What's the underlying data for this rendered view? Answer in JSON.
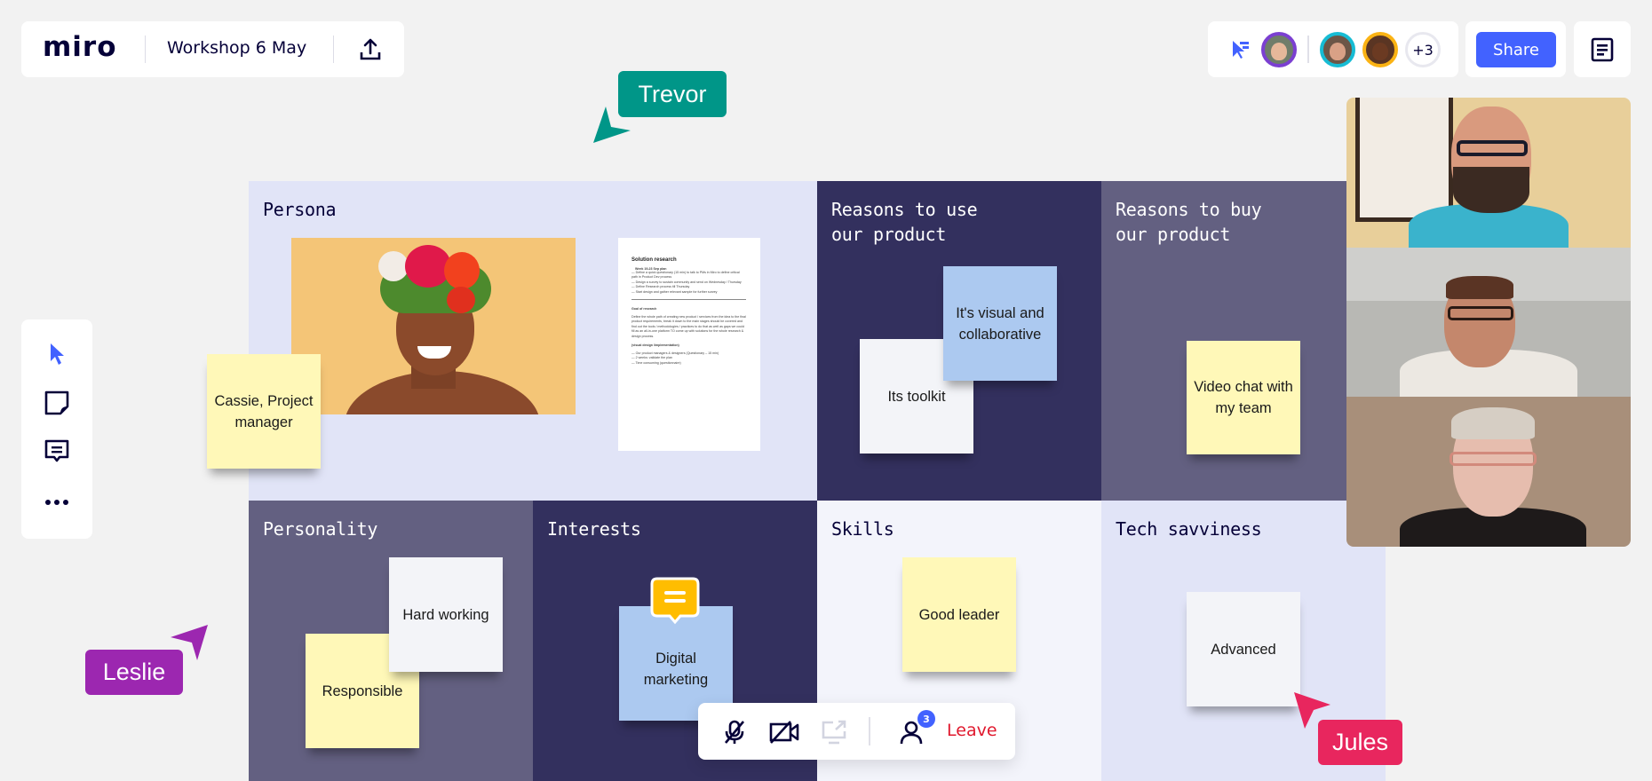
{
  "app": {
    "logo": "miro",
    "board_title": "Workshop 6 May",
    "upload_icon": "upload-icon"
  },
  "collaborators": {
    "follow_icon": "follow-cursor-icon",
    "avatars": [
      {
        "name": "user-avatar-1",
        "ring": "#7b3fd1",
        "skin": "#e6b89a",
        "bg": "#6f7d6a"
      },
      {
        "name": "user-avatar-2",
        "ring": "#17bcd4",
        "skin": "#d9a186",
        "bg": "#6c5647"
      },
      {
        "name": "user-avatar-3",
        "ring": "#fbb313",
        "skin": "#6b3a22",
        "bg": "#5a3523"
      }
    ],
    "overflow_count": "+3"
  },
  "share": {
    "label": "Share",
    "color": "#4262ff"
  },
  "notes_icon": "document-icon",
  "toolbar": {
    "tools": [
      {
        "name": "select-tool",
        "icon": "cursor-icon"
      },
      {
        "name": "sticky-note-tool",
        "icon": "sticky-note-icon"
      },
      {
        "name": "comment-tool",
        "icon": "comment-icon"
      },
      {
        "name": "more-tools",
        "icon": "more-icon"
      }
    ]
  },
  "board": {
    "panels": [
      {
        "id": "persona",
        "title": "Persona",
        "bg": "#e1e4f7",
        "theme": "light"
      },
      {
        "id": "reasons-use",
        "title": "Reasons to use\nour product",
        "bg": "#33305e",
        "theme": "dark"
      },
      {
        "id": "reasons-buy",
        "title": "Reasons to buy\nour product",
        "bg": "#636081",
        "theme": "dark"
      },
      {
        "id": "personality",
        "title": "Personality",
        "bg": "#636081",
        "theme": "dark"
      },
      {
        "id": "interests",
        "title": "Interests",
        "bg": "#33305e",
        "theme": "dark"
      },
      {
        "id": "skills",
        "title": "Skills",
        "bg": "#f3f4fb",
        "theme": "light"
      },
      {
        "id": "tech",
        "title": "Tech savviness",
        "bg": "#e1e4f7",
        "theme": "light"
      }
    ],
    "stickies": {
      "cassie": "Cassie, Project manager",
      "visual": "It's visual and collaborative",
      "toolkit": "Its toolkit",
      "video_chat": "Video chat with my team",
      "hard_working": "Hard working",
      "responsible": "Responsible",
      "digital": "Digital marketing",
      "good_leader": "Good leader",
      "advanced": "Advanced"
    },
    "document": {
      "title": "Solution research",
      "week_heading": "Week 19-23 Sep plan",
      "week_items": [
        "— Define a quick questionary (15 min) to talk to PMs in Miro to define critical path in Product Dev process",
        "— Design a survey to sustain community and send on Wednesday / Thursday",
        "— Define Research process till Thursday",
        "— Start design and gather relevant sample for further survey"
      ],
      "goal_heading": "Goal of research",
      "goal_text": "Define the whole path of creating new product / services from the idea to the final product requirements, break it down to the main stages should be covered and find out the tools / methodologies / practices to do that as well as gaps we could fill as an all-in-one platform TO come up with solutions for the whole research & design process.",
      "impl_heading": "(visual design /implementation)",
      "impl_items": [
        "— Our product managers & designers (Questionary – 15 min)",
        "— 2 weeks: validate the plan",
        "— Time consuming (questionnaire)"
      ]
    },
    "comment_icon": "comment-bubble-icon"
  },
  "cursors": [
    {
      "name": "Trevor",
      "color": "#009688"
    },
    {
      "name": "Leslie",
      "color": "#9c27b0"
    },
    {
      "name": "Jules",
      "color": "#e8265e"
    }
  ],
  "video": {
    "participants": [
      "participant-1",
      "participant-2",
      "participant-3"
    ]
  },
  "call_bar": {
    "mic_icon": "mic-off-icon",
    "camera_icon": "camera-off-icon",
    "screen_icon": "screen-share-icon",
    "people_icon": "participants-icon",
    "participant_count": "3",
    "leave_label": "Leave",
    "leave_color": "#e0182d"
  }
}
